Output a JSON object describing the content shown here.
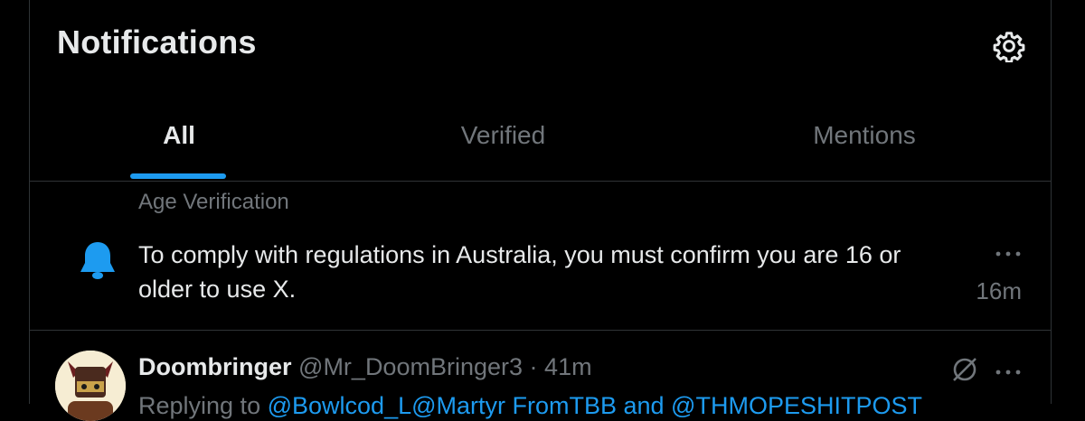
{
  "header": {
    "title": "Notifications",
    "settings_icon": "gear-icon"
  },
  "tabs": [
    {
      "label": "All",
      "active": true
    },
    {
      "label": "Verified",
      "active": false
    },
    {
      "label": "Mentions",
      "active": false
    }
  ],
  "colors": {
    "accent": "#1d9bf0",
    "text": "#e7e9ea",
    "muted": "#71767b",
    "border": "#2f3336",
    "background": "#000000"
  },
  "notification": {
    "heading": "Age Verification",
    "icon": "bell-icon",
    "text": "To comply with regulations in Australia, you must confirm you are 16 or older to use X.",
    "time": "16m"
  },
  "tweet": {
    "name": "Doombringer",
    "handle": "@Mr_DoomBringer3",
    "separator": "·",
    "time": "41m",
    "reply_prefix": "Replying to",
    "reply_links": "@Bowlcod_L@Martyr FromTBB and @THMOPESHITPOST"
  }
}
